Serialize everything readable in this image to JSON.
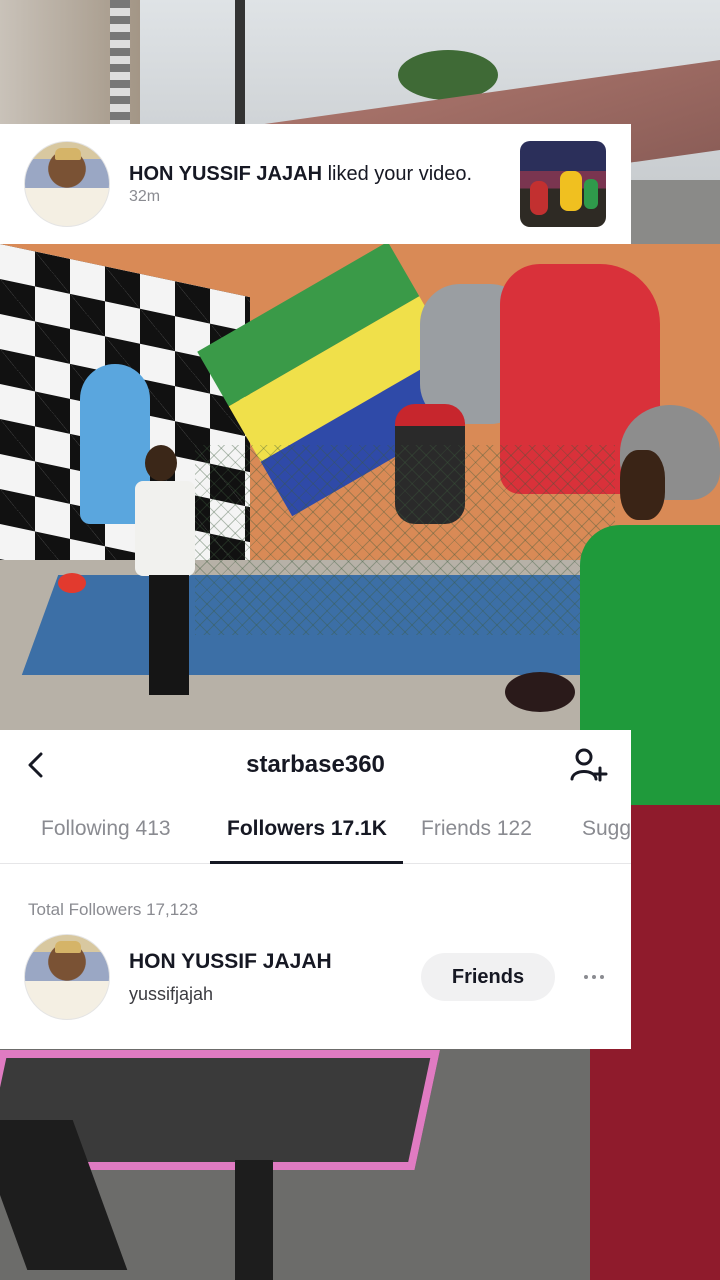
{
  "notification": {
    "name": "HON YUSSIF JAJAH",
    "action": "liked your video.",
    "time": "32m",
    "avatar_icon": "profile-photo",
    "thumbnail_icon": "video-thumbnail"
  },
  "profile": {
    "username": "starbase360",
    "back_icon": "chevron-left-icon",
    "add_icon": "add-user-icon"
  },
  "tabs": [
    {
      "label": "Following 413",
      "active": false
    },
    {
      "label": "Followers 17.1K",
      "active": true
    },
    {
      "label": "Friends 122",
      "active": false
    },
    {
      "label": "Sugg",
      "active": false
    }
  ],
  "followers": {
    "total_label": "Total Followers 17,123",
    "items": [
      {
        "name": "HON YUSSIF JAJAH",
        "handle": "yussifjajah",
        "button_label": "Friends"
      }
    ]
  },
  "colors": {
    "text_primary": "#161823",
    "text_secondary": "#8a8b91",
    "button_bg": "#f1f1f2"
  }
}
